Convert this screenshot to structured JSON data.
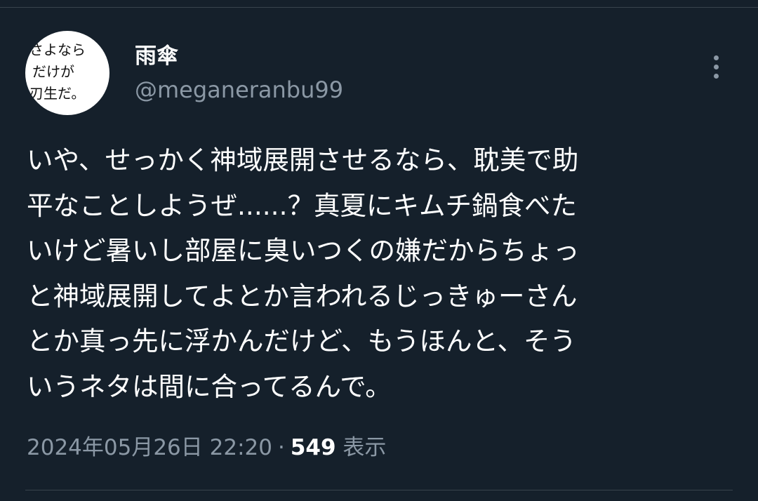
{
  "author": {
    "display_name": "雨傘",
    "handle": "@meganeranbu99",
    "avatar_lines": [
      "さよなら",
      "だけが",
      "刃生だ。"
    ]
  },
  "tweet": {
    "lines": [
      "いや、せっかく神域展開させるなら、耽美で助",
      "平なことしようぜ......？真夏にキムチ鍋食べた",
      "いけど暑いし部屋に臭いつくの嫌だからちょっ",
      "と神域展開してよとか言われるじっきゅーさん",
      "とか真っ先に浮かんだけど、もうほんと、そう",
      "いうネタは間に合ってるんで。"
    ]
  },
  "meta": {
    "timestamp": "2024年05月26日 22:20",
    "separator": "·",
    "views_count": "549",
    "views_label": "表示"
  },
  "icons": {
    "more": "more-vertical-icon"
  },
  "colors": {
    "background": "#15202b",
    "text_primary": "#ffffff",
    "text_secondary": "#8b98a5",
    "divider": "#38444d"
  }
}
